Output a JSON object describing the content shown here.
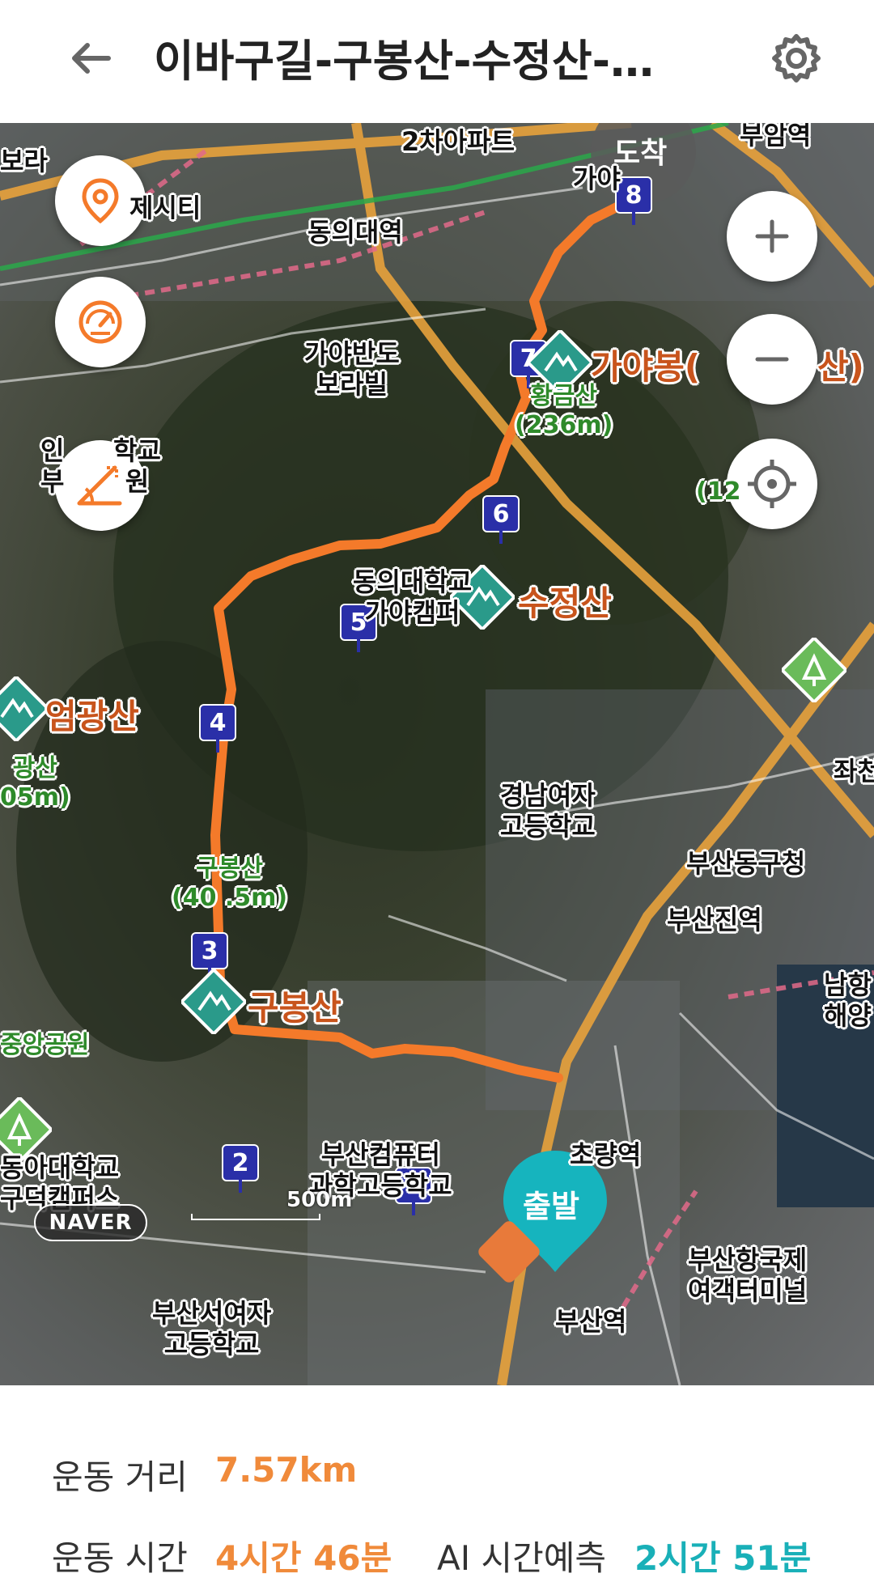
{
  "header": {
    "title": "이바구길-구봉산-수정산-…",
    "back_icon": "arrow-left-icon",
    "settings_icon": "gear-icon"
  },
  "map": {
    "controls": {
      "location_icon": "map-pin-icon",
      "speed_icon": "speedometer-icon",
      "slope_icon": "elevation-slope-icon",
      "zoom_in_icon": "plus-icon",
      "zoom_out_icon": "minus-icon",
      "locate_icon": "crosshair-icon"
    },
    "markers": {
      "start": "출발",
      "end": "도착"
    },
    "waypoints": [
      "1",
      "2",
      "3",
      "4",
      "5",
      "6",
      "7",
      "8"
    ],
    "peaks": {
      "gayabong": "가야봉(",
      "gayabong_tail": "산)",
      "sujeongsan": "수정산",
      "eomgwangsan": "엄광산",
      "gubongsan": "구봉산"
    },
    "labels": {
      "apartment2": "2차아파트",
      "buamyeok": "부암역",
      "bura": "보라",
      "jesiti": "제시티",
      "dongui_station": "동의대역",
      "gaya_partial": "가야",
      "gaya_bandoboraville": "가야반도\n보라빌",
      "hakgyo_partial": "인\n부",
      "hakgyo_tail": "학교\n원",
      "dongui_campus": "동의대학교\n가야캠퍼",
      "gyeongnam_girls": "경남여자\n고등학교",
      "busan_donggu": "부산동구청",
      "busanjin_station": "부산진역",
      "jwacheon": "좌천",
      "namhang": "남항\n해양",
      "busan_computer_hs": "부산컴퓨터\n과학고등학교",
      "choryang_station": "초량역",
      "busan_station": "부산역",
      "busan_ferry": "부산항국제\n여객터미널",
      "donga_univ": "동아대학교\n구덕캠퍼스",
      "junganggongwon": "중앙공원",
      "busan_girls_hs": "부산서여자\n고등학교",
      "naver": "NAVER",
      "scale": "500m"
    },
    "elevations": {
      "hwangsan": "황금산\n(236m)",
      "gubong": "구봉산\n(40 .5m)",
      "eomgwang_partial": "광산\n05m)",
      "right_partial": "(12"
    }
  },
  "stats": {
    "distance_label": "운동 거리",
    "distance_value": "7.57km",
    "time_label": "운동 시간",
    "time_value": "4시간 46분",
    "ai_label": "AI 시간예측",
    "ai_value": "2시간 51분"
  },
  "colors": {
    "route": "#f47a2a",
    "waypoint": "#2a2fa8",
    "peak_icon": "#2a9a8a",
    "start_marker": "#16b4be",
    "stat_orange": "#f08a3a",
    "stat_teal": "#19b0b8"
  }
}
